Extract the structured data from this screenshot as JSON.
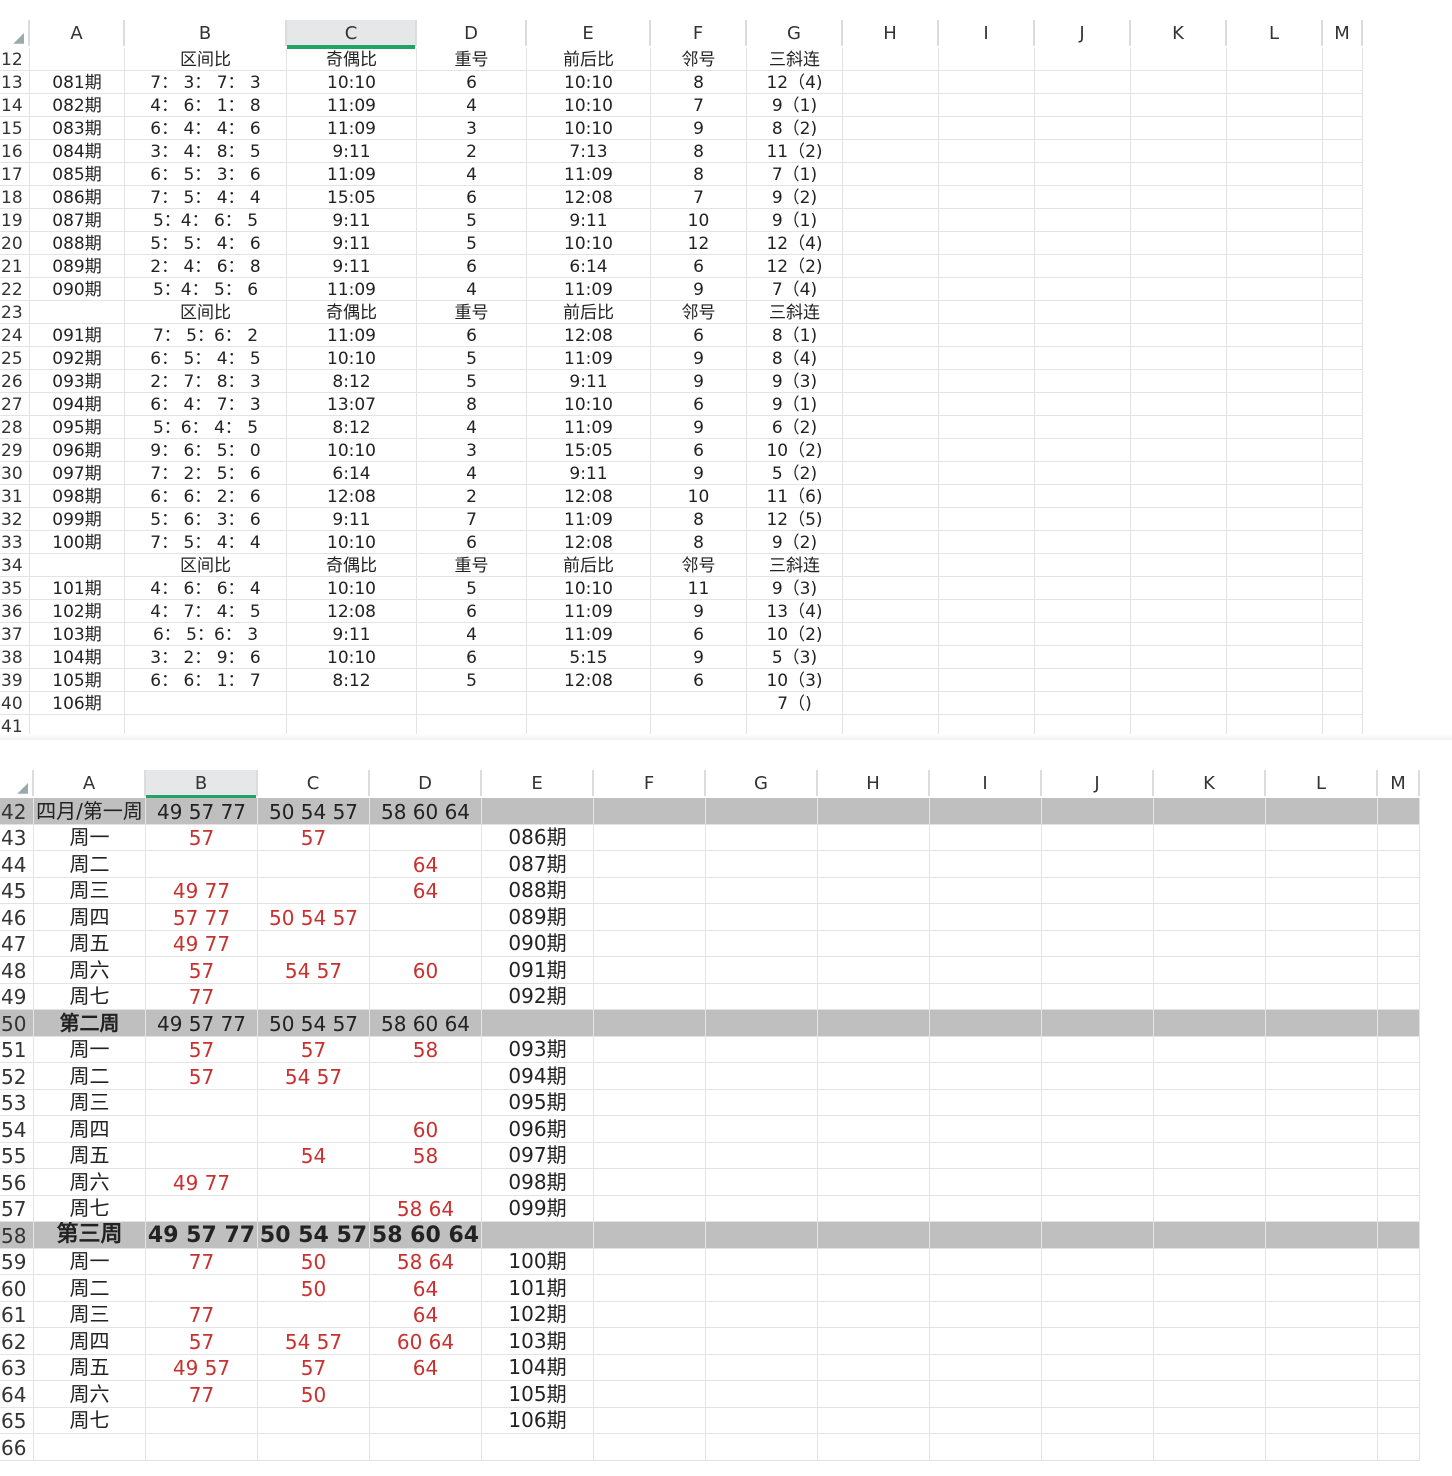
{
  "pane1": {
    "columns": [
      "A",
      "B",
      "C",
      "D",
      "E",
      "F",
      "G",
      "H",
      "I",
      "J",
      "K",
      "L",
      "M"
    ],
    "selected_column": "C",
    "rows": [
      {
        "n": "12",
        "c": [
          "",
          "区间比",
          "奇偶比",
          "重号",
          "前后比",
          "邻号",
          "三斜连"
        ]
      },
      {
        "n": "13",
        "c": [
          "081期",
          "7： 3： 7： 3",
          "10:10",
          "6",
          "10:10",
          "8",
          "12（4)"
        ]
      },
      {
        "n": "14",
        "c": [
          "082期",
          "4： 6： 1： 8",
          "11:09",
          "4",
          "10:10",
          "7",
          "9（1)"
        ]
      },
      {
        "n": "15",
        "c": [
          "083期",
          "6： 4： 4： 6",
          "11:09",
          "3",
          "10:10",
          "9",
          "8（2)"
        ]
      },
      {
        "n": "16",
        "c": [
          "084期",
          "3： 4： 8： 5",
          "9:11",
          "2",
          "7:13",
          "8",
          "11（2)"
        ]
      },
      {
        "n": "17",
        "c": [
          "085期",
          "6： 5： 3： 6",
          "11:09",
          "4",
          "11:09",
          "8",
          "7（1)"
        ]
      },
      {
        "n": "18",
        "c": [
          "086期",
          "7： 5： 4： 4",
          "15:05",
          "6",
          "12:08",
          "7",
          "9（2)"
        ]
      },
      {
        "n": "19",
        "c": [
          "087期",
          "5：4： 6： 5",
          "9:11",
          "5",
          "9:11",
          "10",
          "9（1)"
        ]
      },
      {
        "n": "20",
        "c": [
          "088期",
          "5： 5： 4： 6",
          "9:11",
          "5",
          "10:10",
          "12",
          "12（4)"
        ]
      },
      {
        "n": "21",
        "c": [
          "089期",
          "2： 4： 6： 8",
          "9:11",
          "6",
          "6:14",
          "6",
          "12（2)"
        ]
      },
      {
        "n": "22",
        "c": [
          "090期",
          "5：4： 5： 6",
          "11:09",
          "4",
          "11:09",
          "9",
          "7（4)"
        ]
      },
      {
        "n": "23",
        "c": [
          "",
          "区间比",
          "奇偶比",
          "重号",
          "前后比",
          "邻号",
          "三斜连"
        ]
      },
      {
        "n": "24",
        "c": [
          "091期",
          "7： 5：6： 2",
          "11:09",
          "6",
          "12:08",
          "6",
          "8（1)"
        ]
      },
      {
        "n": "25",
        "c": [
          "092期",
          "6： 5： 4： 5",
          "10:10",
          "5",
          "11:09",
          "9",
          "8（4)"
        ]
      },
      {
        "n": "26",
        "c": [
          "093期",
          "2： 7： 8： 3",
          "8:12",
          "5",
          "9:11",
          "9",
          "9（3)"
        ]
      },
      {
        "n": "27",
        "c": [
          "094期",
          "6： 4： 7： 3",
          "13:07",
          "8",
          "10:10",
          "6",
          "9（1)"
        ]
      },
      {
        "n": "28",
        "c": [
          "095期",
          "5：6： 4： 5",
          "8:12",
          "4",
          "11:09",
          "9",
          "6（2)"
        ]
      },
      {
        "n": "29",
        "c": [
          "096期",
          "9： 6： 5： 0",
          "10:10",
          "3",
          "15:05",
          "6",
          "10（2)"
        ]
      },
      {
        "n": "30",
        "c": [
          "097期",
          "7： 2： 5： 6",
          "6:14",
          "4",
          "9:11",
          "9",
          "5（2)"
        ]
      },
      {
        "n": "31",
        "c": [
          "098期",
          "6： 6： 2： 6",
          "12:08",
          "2",
          "12:08",
          "10",
          "11（6)"
        ]
      },
      {
        "n": "32",
        "c": [
          "099期",
          "5： 6： 3： 6",
          "9:11",
          "7",
          "11:09",
          "8",
          "12（5)"
        ]
      },
      {
        "n": "33",
        "c": [
          "100期",
          "7： 5： 4： 4",
          "10:10",
          "6",
          "12:08",
          "8",
          "9（2)"
        ]
      },
      {
        "n": "34",
        "c": [
          "",
          "区间比",
          "奇偶比",
          "重号",
          "前后比",
          "邻号",
          "三斜连"
        ]
      },
      {
        "n": "35",
        "c": [
          "101期",
          "4： 6： 6： 4",
          "10:10",
          "5",
          "10:10",
          "11",
          "9（3)"
        ]
      },
      {
        "n": "36",
        "c": [
          "102期",
          "4： 7： 4： 5",
          "12:08",
          "6",
          "11:09",
          "9",
          "13（4)"
        ]
      },
      {
        "n": "37",
        "c": [
          "103期",
          "6： 5：6： 3",
          "9:11",
          "4",
          "11:09",
          "6",
          "10（2)"
        ]
      },
      {
        "n": "38",
        "c": [
          "104期",
          "3： 2： 9： 6",
          "10:10",
          "6",
          "5:15",
          "9",
          "5（3)"
        ]
      },
      {
        "n": "39",
        "c": [
          "105期",
          "6： 6： 1： 7",
          "8:12",
          "5",
          "12:08",
          "6",
          "10（3)"
        ]
      },
      {
        "n": "40",
        "c": [
          "106期",
          "",
          "",
          "",
          "",
          "",
          "7（)"
        ]
      },
      {
        "n": "41",
        "c": [
          "",
          "",
          "",
          "",
          "",
          "",
          ""
        ]
      }
    ]
  },
  "pane2": {
    "columns": [
      "A",
      "B",
      "C",
      "D",
      "E",
      "F",
      "G",
      "H",
      "I",
      "J",
      "K",
      "L",
      "M"
    ],
    "selected_column": "B",
    "rows": [
      {
        "n": "42",
        "shade": true,
        "c": [
          "四月/第一周",
          "49 57 77",
          "50 54 57",
          "58 60 64",
          ""
        ]
      },
      {
        "n": "43",
        "c": [
          "周一",
          "57",
          "57",
          "",
          "086期"
        ]
      },
      {
        "n": "44",
        "c": [
          "周二",
          "",
          "",
          "64",
          "087期"
        ]
      },
      {
        "n": "45",
        "c": [
          "周三",
          "49 77",
          "",
          "64",
          "088期"
        ]
      },
      {
        "n": "46",
        "c": [
          "周四",
          "57 77",
          "50 54 57",
          "",
          "089期"
        ]
      },
      {
        "n": "47",
        "c": [
          "周五",
          "49 77",
          "",
          "",
          "090期"
        ]
      },
      {
        "n": "48",
        "c": [
          "周六",
          "57",
          "54 57",
          "60",
          "091期"
        ]
      },
      {
        "n": "49",
        "c": [
          "周七",
          "77",
          "",
          "",
          "092期"
        ]
      },
      {
        "n": "50",
        "shade": true,
        "c": [
          "第二周",
          "49 57 77",
          "50 54 57",
          "58 60 64",
          ""
        ]
      },
      {
        "n": "51",
        "c": [
          "周一",
          "57",
          "57",
          "58",
          "093期"
        ]
      },
      {
        "n": "52",
        "c": [
          "周二",
          "57",
          "54 57",
          "",
          "094期"
        ]
      },
      {
        "n": "53",
        "c": [
          "周三",
          "",
          "",
          "",
          "095期"
        ]
      },
      {
        "n": "54",
        "c": [
          "周四",
          "",
          "",
          "60",
          "096期"
        ]
      },
      {
        "n": "55",
        "c": [
          "周五",
          "",
          "54",
          "58",
          "097期"
        ]
      },
      {
        "n": "56",
        "c": [
          "周六",
          "49 77",
          "",
          "",
          "098期"
        ]
      },
      {
        "n": "57",
        "c": [
          "周七",
          "",
          "",
          "58 64",
          "099期"
        ]
      },
      {
        "n": "58",
        "shade": true,
        "big": true,
        "c": [
          "第三周",
          "49 57 77",
          "50 54 57",
          "58 60 64",
          ""
        ]
      },
      {
        "n": "59",
        "c": [
          "周一",
          "77",
          "50",
          "58 64",
          "100期"
        ]
      },
      {
        "n": "60",
        "c": [
          "周二",
          "",
          "50",
          "64",
          "101期"
        ]
      },
      {
        "n": "61",
        "c": [
          "周三",
          "77",
          "",
          "64",
          "102期"
        ]
      },
      {
        "n": "62",
        "c": [
          "周四",
          "57",
          "54 57",
          "60 64",
          "103期"
        ]
      },
      {
        "n": "63",
        "c": [
          "周五",
          "49 57",
          "57",
          "64",
          "104期"
        ]
      },
      {
        "n": "64",
        "c": [
          "周六",
          "77",
          "50",
          "",
          "105期"
        ]
      },
      {
        "n": "65",
        "c": [
          "周七",
          "",
          "",
          "",
          "106期"
        ]
      },
      {
        "n": "66",
        "c": [
          "",
          "",
          "",
          "",
          ""
        ]
      }
    ]
  },
  "colors": {
    "red_text": "#c8312f",
    "shade_row": "#bfbfbf",
    "selected_header": "#21a366",
    "grid": "#e3e3e3"
  }
}
